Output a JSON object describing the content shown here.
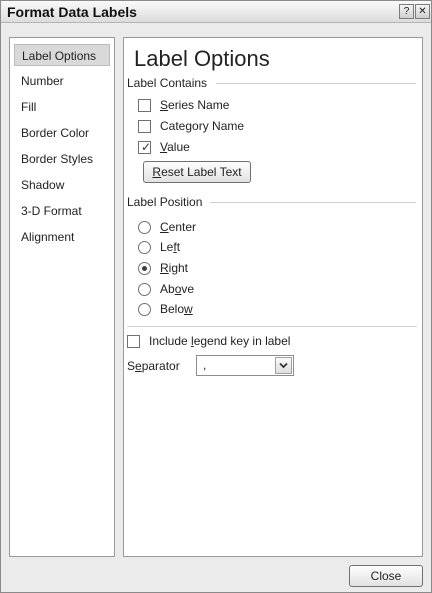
{
  "window": {
    "title": "Format Data Labels",
    "help_glyph": "?",
    "close_glyph": "✕"
  },
  "nav": {
    "items": [
      {
        "label": "Label Options",
        "selected": true
      },
      {
        "label": "Number"
      },
      {
        "label": "Fill"
      },
      {
        "label": "Border Color"
      },
      {
        "label": "Border Styles"
      },
      {
        "label": "Shadow"
      },
      {
        "label": "3-D Format"
      },
      {
        "label": "Alignment"
      }
    ]
  },
  "panel": {
    "heading": "Label Options",
    "label_contains": {
      "title": "Label Contains",
      "series_name": {
        "pre": "",
        "u": "S",
        "post": "eries Name",
        "checked": false
      },
      "category_name": {
        "pre": "Cate",
        "u": "g",
        "post": "ory Name",
        "checked": false
      },
      "value": {
        "pre": "",
        "u": "V",
        "post": "alue",
        "checked": true
      },
      "checkmark": "✓",
      "reset_button": {
        "pre": "",
        "u": "R",
        "post": "eset Label Text"
      }
    },
    "label_position": {
      "title": "Label Position",
      "options": {
        "center": {
          "pre": "",
          "u": "C",
          "post": "enter",
          "selected": false
        },
        "left": {
          "pre": "Le",
          "u": "f",
          "post": "t",
          "selected": false
        },
        "right": {
          "pre": "",
          "u": "R",
          "post": "ight",
          "selected": true
        },
        "above": {
          "pre": "Ab",
          "u": "o",
          "post": "ve",
          "selected": false
        },
        "below": {
          "pre": "Belo",
          "u": "w",
          "post": "",
          "selected": false
        }
      }
    },
    "include_legend_key": {
      "pre": "Include ",
      "u": "l",
      "post": "egend key in label",
      "checked": false
    },
    "separator": {
      "pre": "S",
      "u": "e",
      "post": "parator",
      "value": ","
    }
  },
  "footer": {
    "close_button": "Close"
  }
}
